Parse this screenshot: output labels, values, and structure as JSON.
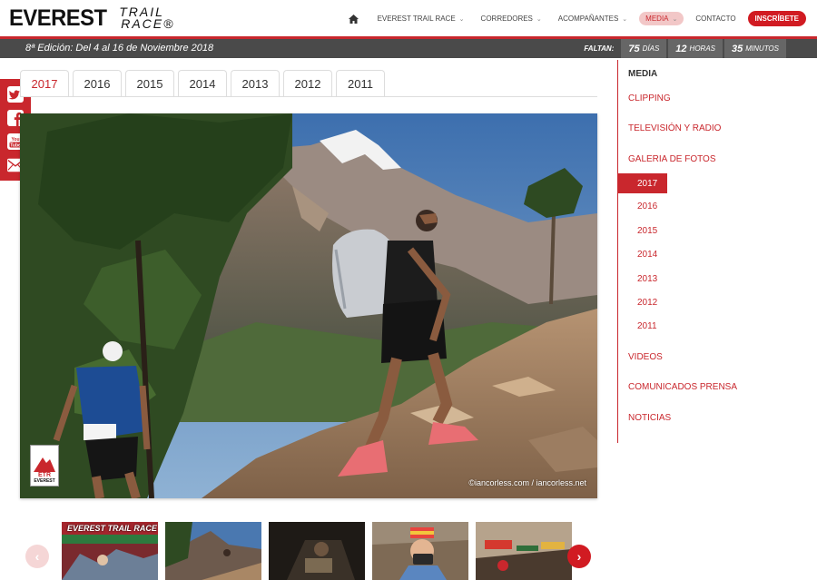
{
  "header": {
    "logo_main": "EVEREST",
    "logo_sub_1": "TRAIL",
    "logo_sub_2": "RACE®",
    "nav": [
      {
        "label": "EVEREST TRAIL RACE",
        "dropdown": true
      },
      {
        "label": "CORREDORES",
        "dropdown": true
      },
      {
        "label": "ACOMPAÑANTES",
        "dropdown": true
      },
      {
        "label": "MEDIA",
        "dropdown": true,
        "active": true
      },
      {
        "label": "CONTACTO",
        "dropdown": false
      }
    ],
    "cta": "INSCRÍBETE",
    "home_icon": "home-icon"
  },
  "subbar": {
    "edition": "8ª Edición: Del 4 al 16 de Noviembre 2018",
    "countdown_label": "FALTAN:",
    "days_value": "75",
    "days_unit": "DÍAS",
    "hours_value": "12",
    "hours_unit": "HORAS",
    "minutes_value": "35",
    "minutes_unit": "MINUTOS"
  },
  "social": [
    "twitter-icon",
    "facebook-icon",
    "youtube-icon",
    "email-icon"
  ],
  "tabs": [
    "2017",
    "2016",
    "2015",
    "2014",
    "2013",
    "2012",
    "2011"
  ],
  "active_tab": "2017",
  "photo": {
    "credit": "©iancorless.com / iancorless.net",
    "badge_line1": "ETR",
    "badge_line2": "EVEREST"
  },
  "side_menu": {
    "title": "MEDIA",
    "links_top": [
      "CLIPPING",
      "TELEVISIÓN Y RADIO",
      "GALERIA DE FOTOS"
    ],
    "years": [
      "2017",
      "2016",
      "2015",
      "2014",
      "2013",
      "2012",
      "2011"
    ],
    "active_year": "2017",
    "links_bottom": [
      "VIDEOS",
      "COMUNICADOS PRENSA",
      "NOTICIAS"
    ]
  },
  "thumbnails": {
    "first_caption": "EVEREST TRAIL RACE",
    "prev_icon": "chevron-left-icon",
    "next_icon": "chevron-right-icon"
  },
  "colors": {
    "brand_red": "#c9272d",
    "dark_bar": "#4a4a4a"
  }
}
